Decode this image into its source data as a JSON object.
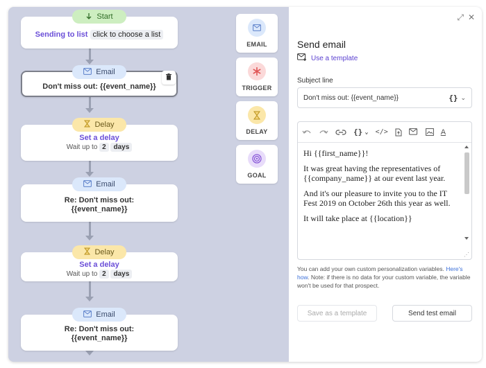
{
  "flow": {
    "start": {
      "pill": "Start",
      "sending_label": "Sending to list",
      "choose_label": "click to choose a list"
    },
    "email1": {
      "pill": "Email",
      "subject": "Don't miss out: {{event_name}}"
    },
    "delay1": {
      "pill": "Delay",
      "title": "Set a delay",
      "prefix": "Wait up to",
      "amount": "2",
      "unit": "days"
    },
    "email2": {
      "pill": "Email",
      "subject": "Re: Don't miss out: {{event_name}}"
    },
    "delay2": {
      "pill": "Delay",
      "title": "Set a delay",
      "prefix": "Wait up to",
      "amount": "2",
      "unit": "days"
    },
    "email3": {
      "pill": "Email",
      "subject": "Re: Don't miss out: {{event_name}}"
    }
  },
  "palette": [
    {
      "label": "EMAIL",
      "icon": "mail-icon",
      "bg": "#dbe8fb",
      "color": "#5b7fc9"
    },
    {
      "label": "TRIGGER",
      "icon": "asterisk-icon",
      "bg": "#fbd9d9",
      "color": "#e05656"
    },
    {
      "label": "DELAY",
      "icon": "hourglass-icon",
      "bg": "#fbe7a9",
      "color": "#b8921f"
    },
    {
      "label": "GOAL",
      "icon": "target-icon",
      "bg": "#e8dcfa",
      "color": "#8a5ad8"
    }
  ],
  "panel": {
    "title": "Send email",
    "use_template": "Use a template",
    "subject_label": "Subject line",
    "subject_value": "Don't miss out: {{event_name}}",
    "variables_button": "{}",
    "body": [
      "Hi {{first_name}}!",
      "It was great having the representatives of {{company_name}} at our event last year.",
      "And it's our pleasure to invite you to the IT Fest 2019 on October 26th this year as well.",
      "It will take place at {{location}}"
    ],
    "help_prefix": "You can add your own custom personalization variables. ",
    "help_link": "Here's how",
    "help_suffix": ". Note: if there is no data for your custom variable, the variable won't be used for that prospect.",
    "save_template": "Save as a template",
    "send_test": "Send test email"
  },
  "colors": {
    "accent": "#6b4fd8",
    "link": "#3b6fd8"
  }
}
